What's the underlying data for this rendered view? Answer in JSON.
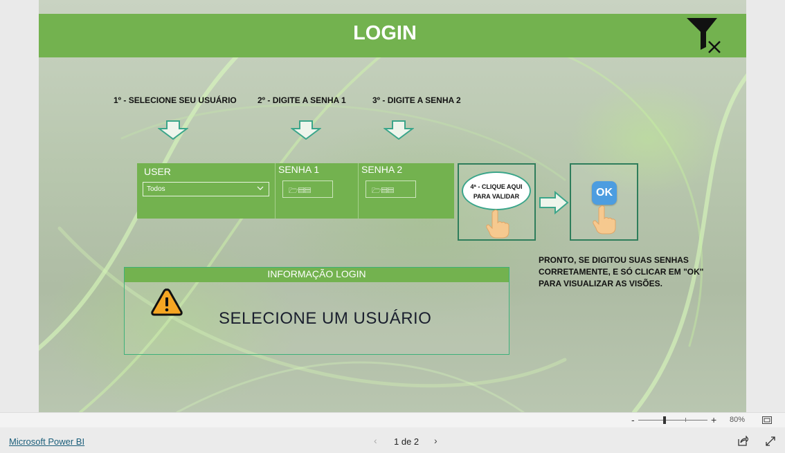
{
  "header": {
    "title": "LOGIN",
    "clear_filters_icon": "filter-clear-icon"
  },
  "steps": {
    "step1": "1º - SELECIONE SEU USUÁRIO",
    "step2": "2º - DIGITE A SENHA 1",
    "step3": "3º - DIGITE A SENHA 2"
  },
  "slicers": {
    "user": {
      "title": "USER",
      "value": "Todos"
    },
    "senha1": {
      "title": "SENHA 1",
      "value": "🗁▤▤"
    },
    "senha2": {
      "title": "SENHA 2",
      "value": "🗁▤▤"
    }
  },
  "validate": {
    "label_line1": "4ª - CLIQUE AQUI",
    "label_line2": "PARA VALIDAR"
  },
  "ok_button": {
    "label": "OK"
  },
  "done_text": "PRONTO, SE DIGITOU SUAS SENHAS CORRETAMENTE, E SÓ CLICAR EM \"OK\" PARA VISUALIZAR AS VISÕES.",
  "info_panel": {
    "header": "INFORMAÇÃO LOGIN",
    "message": "SELECIONE UM USUÁRIO"
  },
  "zoom": {
    "minus": "-",
    "plus": "+",
    "percent": "80%"
  },
  "footer": {
    "brand": "Microsoft Power BI",
    "page_indicator": "1 de 2",
    "prev": "‹",
    "next": "›"
  },
  "colors": {
    "header_green": "#73b24f",
    "teal_outline": "#2e7d5b",
    "ok_blue": "#4d9de0",
    "warning_orange": "#f5a623"
  }
}
